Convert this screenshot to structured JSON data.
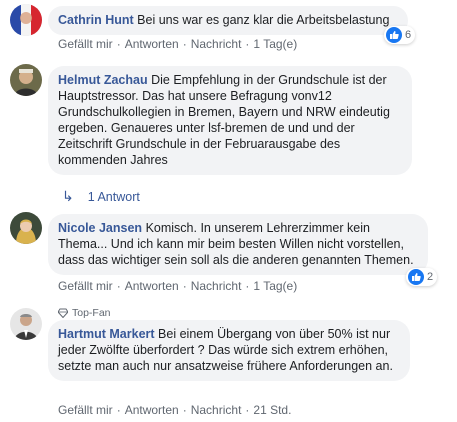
{
  "comments": [
    {
      "author": "Cathrin Hunt",
      "text": "Bei uns war es ganz klar die Arbeitsbelastung",
      "reaction_count": "6",
      "actions": {
        "like": "Gefällt mir",
        "reply": "Antworten",
        "message": "Nachricht",
        "time": "1 Tag(e)"
      }
    },
    {
      "author": "Helmut Zachau",
      "text": "Die Empfehlung in der Grundschule ist der Hauptstressor. Das hat unsere Befragung vonv12 Grundschulkollegien in Bremen, Bayern und NRW eindeutig ergeben. Genaueres unter lsf-bremen de und und der Zeitschrift Grundschule in der Februarausgabe des kommenden Jahres",
      "replies_label": "1 Antwort"
    },
    {
      "author": "Nicole Jansen",
      "text": "Komisch. In unserem Lehrerzimmer kein Thema... Und ich kann mir beim besten Willen nicht vorstellen, dass das wichtiger sein soll als die anderen genannten Themen.",
      "reaction_count": "2",
      "actions": {
        "like": "Gefällt mir",
        "reply": "Antworten",
        "message": "Nachricht",
        "time": "1 Tag(e)"
      }
    },
    {
      "badge": "Top-Fan",
      "author": "Hartmut Markert",
      "text": "Bei einem Übergang von über 50% ist nur jeder Zwölfte überfordert ? Das würde sich extrem erhöhen, setzte man auch nur ansatzweise frühere Anforderungen an.",
      "actions": {
        "like": "Gefällt mir",
        "reply": "Antworten",
        "message": "Nachricht",
        "time": "21 Std."
      }
    }
  ],
  "colors": {
    "author": "#385898",
    "bubble": "#f2f3f5",
    "meta": "#606770",
    "like": "#1877f2"
  },
  "icons": [
    "like-icon",
    "reply-arrow-icon",
    "top-fan-diamond-icon"
  ]
}
